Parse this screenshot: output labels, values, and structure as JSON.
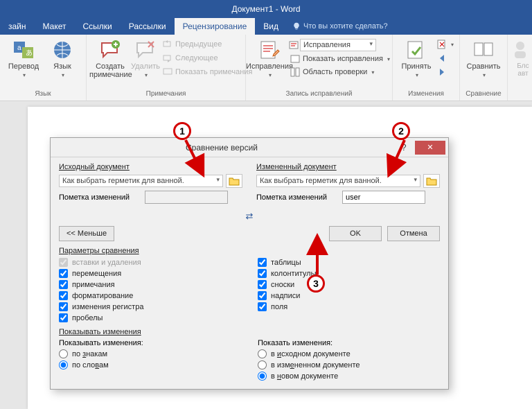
{
  "title": "Документ1 - Word",
  "tabs": {
    "design": "зайн",
    "layout": "Макет",
    "references": "Ссылки",
    "mailings": "Рассылки",
    "review": "Рецензирование",
    "view": "Вид",
    "tellme": "Что вы хотите сделать?"
  },
  "ribbon": {
    "language": {
      "translate": "Перевод",
      "lang": "Язык",
      "group": "Язык"
    },
    "comments": {
      "new": "Создать примечание",
      "delete": "Удалить",
      "prev": "Предыдущее",
      "next": "Следующее",
      "show": "Показать примечания",
      "group": "Примечания"
    },
    "tracking": {
      "track": "Исправления",
      "mode": "Исправления",
      "show": "Показать исправления",
      "pane": "Область проверки",
      "group": "Запись исправлений"
    },
    "changes": {
      "accept": "Принять",
      "group": "Изменения"
    },
    "compare": {
      "btn": "Сравнить",
      "group": "Сравнение"
    },
    "protect": {
      "block": "Блс\nавт"
    }
  },
  "dialog": {
    "title": "Сравнение версий",
    "help": "?",
    "close": "✕",
    "source": {
      "head": "Исходный документ",
      "file": "Как выбрать герметик для ванной.",
      "changes_label": "Пометка изменений",
      "changes_value": ""
    },
    "revised": {
      "head": "Измененный документ",
      "file": "Как выбрать герметик для ванной.",
      "changes_label": "Пометка изменений",
      "changes_value": "user"
    },
    "less": "<<  Меньше",
    "ok": "OK",
    "cancel": "Отмена",
    "params_head": "Параметры сравнения",
    "opts": {
      "insdel": "вставки и удаления",
      "moves": "перемещения",
      "comments": "примечания",
      "formatting": "форматирование",
      "case": "изменения регистра",
      "whitespace": "пробелы",
      "tables": "таблицы",
      "headers": "колонтитулы",
      "footnotes": "сноски",
      "captions": "надписи",
      "fields": "поля"
    },
    "show_head": "Показывать изменения",
    "show_left_label": "Показывать изменения:",
    "show_left": {
      "chars": "по знакам",
      "words": "по словам"
    },
    "show_right_label": "Показать изменения:",
    "show_right": {
      "src": "в исходном документе",
      "rev": "в измененном документе",
      "new": "в новом документе"
    }
  },
  "markers": {
    "m1": "1",
    "m2": "2",
    "m3": "3"
  }
}
